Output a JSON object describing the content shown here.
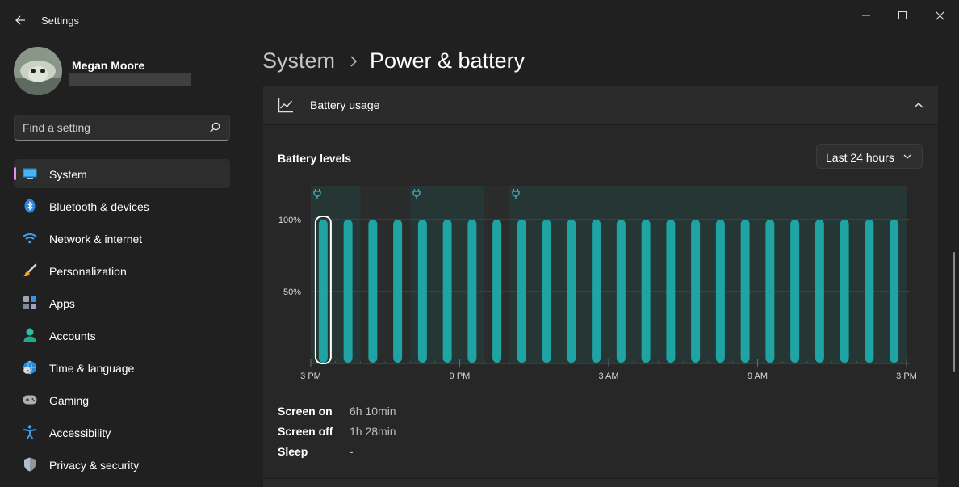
{
  "app": {
    "title": "Settings"
  },
  "profile": {
    "name": "Megan Moore"
  },
  "search": {
    "placeholder": "Find a setting"
  },
  "sidebar": {
    "items": [
      {
        "label": "System",
        "icon": "monitor-icon",
        "selected": true
      },
      {
        "label": "Bluetooth & devices",
        "icon": "bluetooth-icon"
      },
      {
        "label": "Network & internet",
        "icon": "wifi-icon"
      },
      {
        "label": "Personalization",
        "icon": "brush-icon"
      },
      {
        "label": "Apps",
        "icon": "apps-icon"
      },
      {
        "label": "Accounts",
        "icon": "person-icon"
      },
      {
        "label": "Time & language",
        "icon": "globe-clock-icon"
      },
      {
        "label": "Gaming",
        "icon": "gamepad-icon"
      },
      {
        "label": "Accessibility",
        "icon": "accessibility-icon"
      },
      {
        "label": "Privacy & security",
        "icon": "shield-icon"
      }
    ]
  },
  "breadcrumb": {
    "parent": "System",
    "current": "Power & battery"
  },
  "battery_usage": {
    "header": "Battery usage",
    "levels_title": "Battery levels",
    "range": "Last 24 hours",
    "stats": [
      {
        "label": "Screen on",
        "value": "6h 10min"
      },
      {
        "label": "Screen off",
        "value": "1h 28min"
      },
      {
        "label": "Sleep",
        "value": "-"
      }
    ]
  },
  "colors": {
    "accent": "#e28ef5",
    "bar": "#1fa3a3",
    "bar_top": "#2bb7a8",
    "charging_band": "#263634",
    "background": "#202020",
    "card": "#272727"
  },
  "chart_data": {
    "type": "bar",
    "x_ticks": [
      "3 PM",
      "9 PM",
      "3 AM",
      "9 AM",
      "3 PM"
    ],
    "y_ticks": [
      "100%",
      "50%"
    ],
    "ylim": [
      0,
      100
    ],
    "values": [
      100,
      100,
      100,
      100,
      100,
      100,
      100,
      100,
      100,
      100,
      100,
      100,
      100,
      100,
      100,
      100,
      100,
      100,
      100,
      100,
      100,
      100,
      100,
      100
    ],
    "selected_index": 0,
    "charging_periods": [
      [
        0,
        2
      ],
      [
        4,
        7
      ],
      [
        8,
        24
      ]
    ],
    "grid": true
  }
}
